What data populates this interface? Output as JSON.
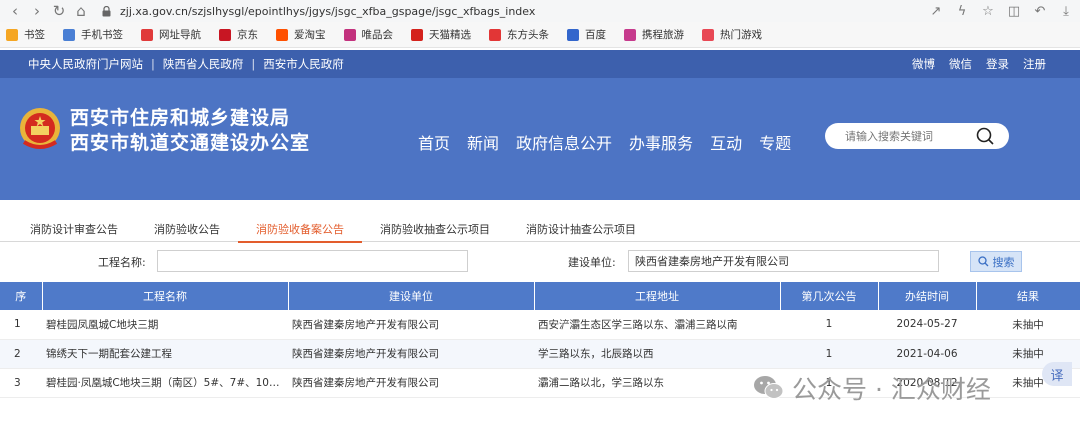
{
  "browser": {
    "url": "zjj.xa.gov.cn/szjslhysgl/epointlhys/jgys/jsgc_xfba_gspage/jsgc_xfbags_index",
    "bookmarks": [
      {
        "label": "书签",
        "color": "#f5a623"
      },
      {
        "label": "手机书签",
        "color": "#4a7fd4"
      },
      {
        "label": "网址导航",
        "color": "#e03a3a"
      },
      {
        "label": "京东",
        "color": "#c81623"
      },
      {
        "label": "爱淘宝",
        "color": "#ff5000"
      },
      {
        "label": "唯品会",
        "color": "#c3327e"
      },
      {
        "label": "天猫精选",
        "color": "#d4221c"
      },
      {
        "label": "东方头条",
        "color": "#e23636"
      },
      {
        "label": "百度",
        "color": "#3366cc"
      },
      {
        "label": "携程旅游",
        "color": "#c63b8d"
      },
      {
        "label": "热门游戏",
        "color": "#e84855"
      }
    ]
  },
  "site": {
    "top_links": [
      "中央人民政府门户网站",
      "陕西省人民政府",
      "西安市人民政府"
    ],
    "top_right": [
      "微博",
      "微信",
      "登录",
      "注册"
    ],
    "title_line1": "西安市住房和城乡建设局",
    "title_line2": "西安市轨道交通建设办公室",
    "nav": [
      "首页",
      "新闻",
      "政府信息公开",
      "办事服务",
      "互动",
      "专题"
    ],
    "search_placeholder": "请输入搜索关键词"
  },
  "tabs": [
    {
      "label": "消防设计审查公告",
      "active": false
    },
    {
      "label": "消防验收公告",
      "active": false
    },
    {
      "label": "消防验收备案公告",
      "active": true
    },
    {
      "label": "消防验收抽查公示项目",
      "active": false
    },
    {
      "label": "消防设计抽查公示项目",
      "active": false
    }
  ],
  "filter": {
    "project_label": "工程名称:",
    "project_value": "",
    "unit_label": "建设单位:",
    "unit_value": "陕西省建秦房地产开发有限公司",
    "search_label": "搜索"
  },
  "table": {
    "headers": [
      "序",
      "工程名称",
      "建设单位",
      "工程地址",
      "第几次公告",
      "办结时间",
      "结果"
    ],
    "rows": [
      [
        "1",
        "碧桂园凤凰城C地块三期",
        "陕西省建秦房地产开发有限公司",
        "西安浐灞生态区学三路以东、灞浦三路以南",
        "1",
        "2024-05-27",
        "未抽中"
      ],
      [
        "2",
        "锦绣天下一期配套公建工程",
        "陕西省建秦房地产开发有限公司",
        "学三路以东，北辰路以西",
        "1",
        "2021-04-06",
        "未抽中"
      ],
      [
        "3",
        "碧桂园·凤凰城C地块三期（南区）5#、7#、10#、...",
        "陕西省建秦房地产开发有限公司",
        "灞浦二路以北，学三路以东",
        "1",
        "2020-08-12",
        "未抽中"
      ]
    ]
  },
  "watermark": "公众号 · 汇众财经",
  "fab_label": "译",
  "colors": {
    "header_blue": "#4d74c4",
    "active_tab": "#e35d2d",
    "table_head": "#4f7ac9"
  }
}
